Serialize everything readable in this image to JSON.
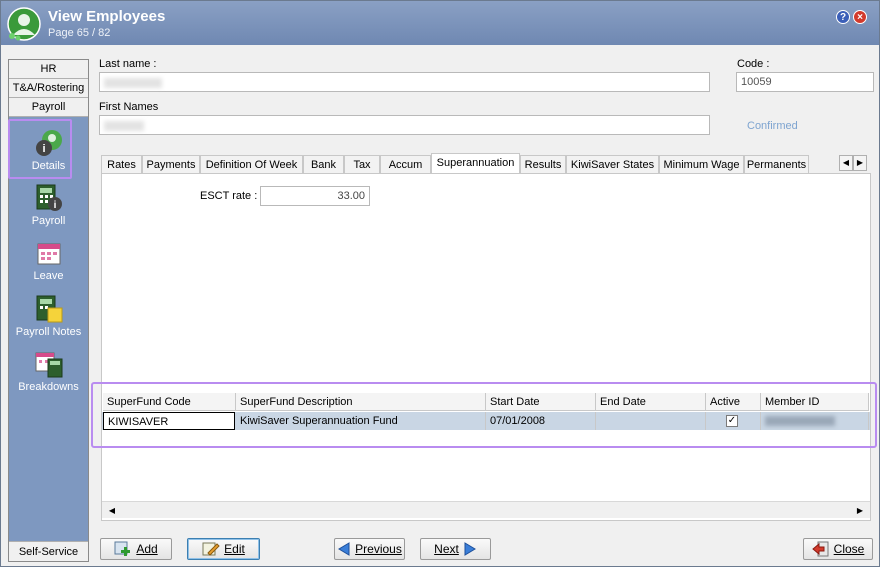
{
  "window": {
    "title": "View Employees",
    "subtitle": "Page 65 / 82",
    "help_label": "?",
    "close_label": "×"
  },
  "sidebar": {
    "tabs": [
      "HR",
      "T&A/Rostering",
      "Payroll"
    ],
    "items": [
      {
        "label": "Details",
        "icon": "person-info-icon"
      },
      {
        "label": "Payroll",
        "icon": "calculator-info-icon"
      },
      {
        "label": "Leave",
        "icon": "calendar-icon"
      },
      {
        "label": "Payroll Notes",
        "icon": "calculator-note-icon"
      },
      {
        "label": "Breakdowns",
        "icon": "calendar-calculator-icon"
      }
    ],
    "bottom_tab": "Self-Service"
  },
  "form": {
    "last_name_label": "Last name :",
    "first_names_label": "First Names",
    "code_label": "Code :",
    "code_value": "10059",
    "confirmed_text": "Confirmed"
  },
  "tabs": [
    "Rates",
    "Payments",
    "Definition Of Week",
    "Bank",
    "Tax",
    "Accum",
    "Superannuation",
    "Results",
    "KiwiSaver States",
    "Minimum Wage",
    "Permanents"
  ],
  "active_tab": "Superannuation",
  "tab_arrows": {
    "left": "◀",
    "right": "▶"
  },
  "super": {
    "esct_label": "ESCT rate :",
    "esct_value": "33.00"
  },
  "grid": {
    "columns": [
      "SuperFund Code",
      "SuperFund Description",
      "Start Date",
      "End Date",
      "Active",
      "Member ID"
    ],
    "rows": [
      {
        "code": "KIWISAVER",
        "description": "KiwiSaver Superannuation Fund",
        "start_date": "07/01/2008",
        "end_date": "",
        "active_mark": "✓",
        "member_id": ""
      }
    ]
  },
  "scroll": {
    "left": "◀",
    "right": "▶"
  },
  "buttons": {
    "add": "Add",
    "edit": "Edit",
    "previous": "Previous",
    "next": "Next",
    "close": "Close"
  }
}
